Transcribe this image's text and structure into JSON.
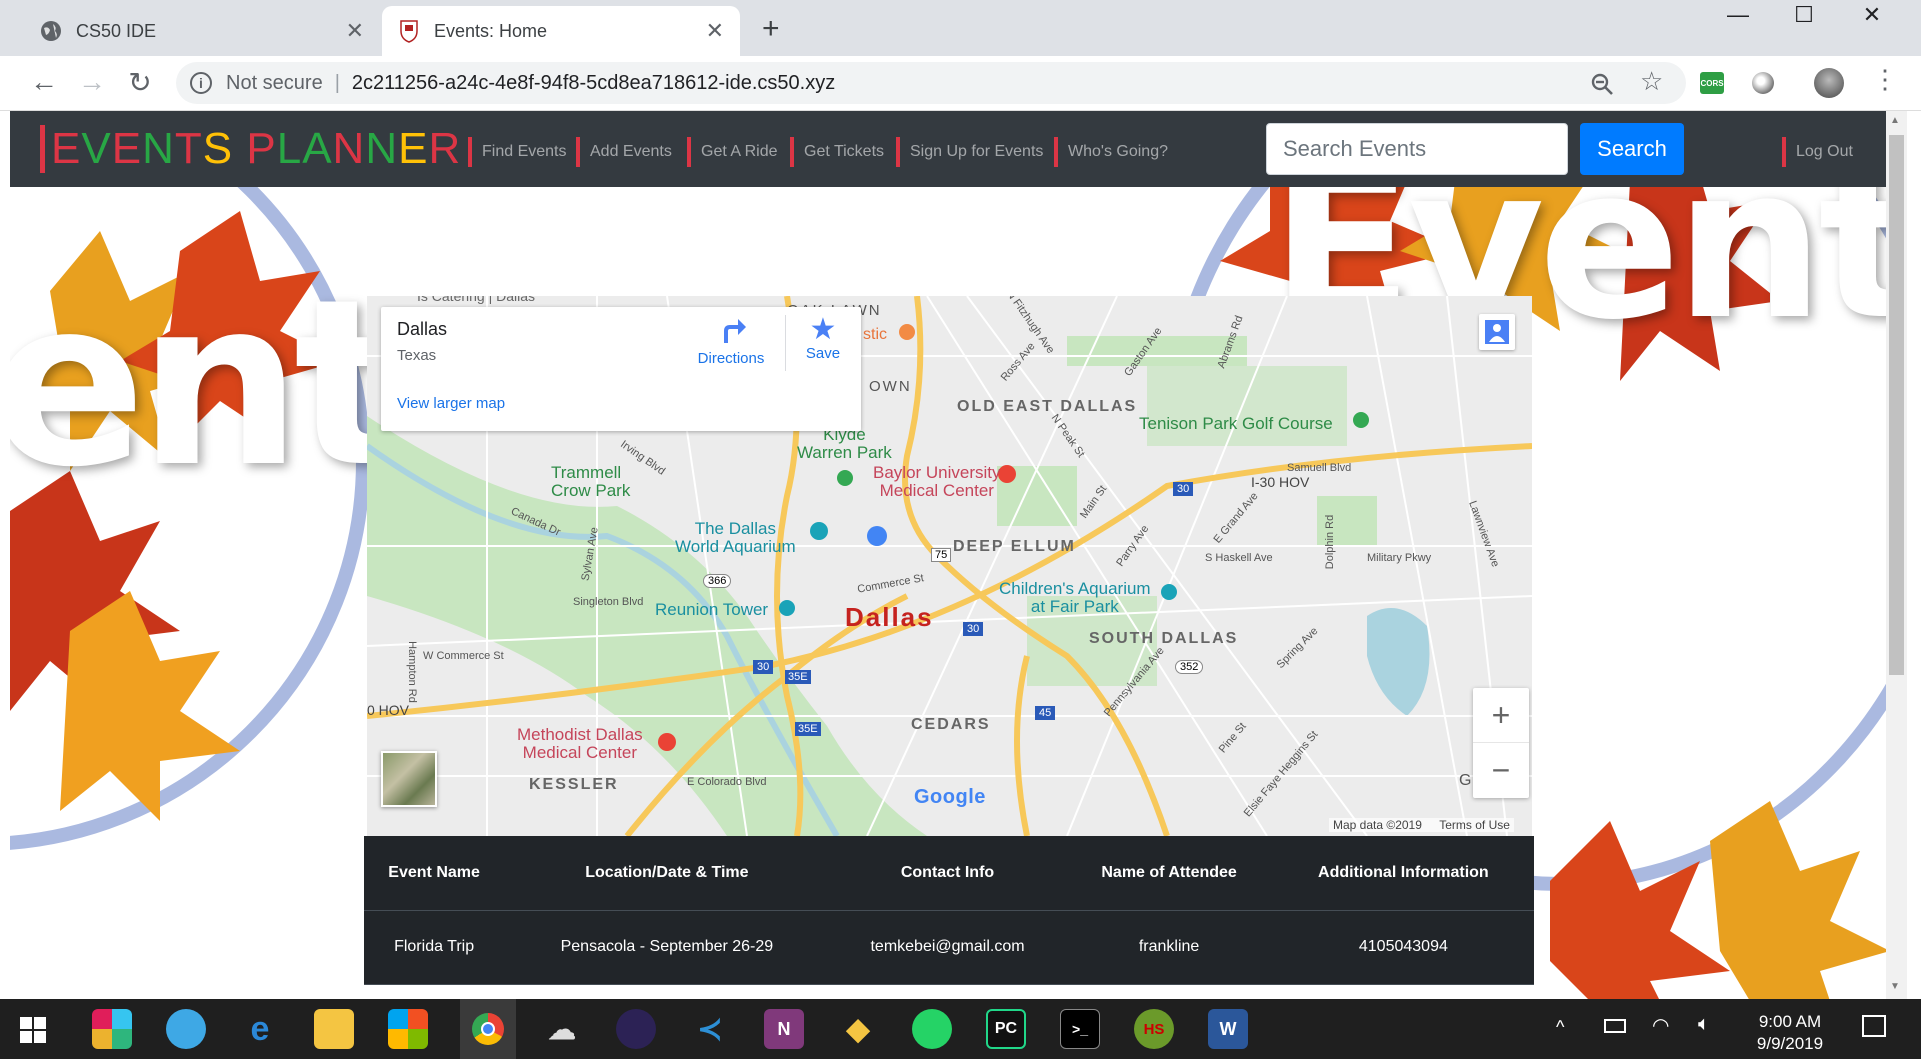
{
  "browser": {
    "tabs": [
      {
        "title": "CS50 IDE",
        "close": "✕"
      },
      {
        "title": "Events: Home",
        "close": "✕"
      }
    ],
    "new_tab": "+",
    "window_controls": {
      "minimize": "—",
      "maximize": "☐",
      "close": "✕"
    },
    "security_label": "Not secure",
    "url": "2c211256-a24c-4e8f-94f8-5cd8ea718612-ide.cs50.xyz",
    "cors_badge": "CORS"
  },
  "navbar": {
    "brand_letters": [
      {
        "ch": "E",
        "color": "#dc3545"
      },
      {
        "ch": "V",
        "color": "#28a745"
      },
      {
        "ch": "E",
        "color": "#dc3545"
      },
      {
        "ch": "N",
        "color": "#28a745"
      },
      {
        "ch": "T",
        "color": "#dc3545"
      },
      {
        "ch": "S",
        "color": "#ffc107"
      },
      {
        "ch": " ",
        "color": "#ffffff"
      },
      {
        "ch": "P",
        "color": "#dc3545"
      },
      {
        "ch": "L",
        "color": "#28a745"
      },
      {
        "ch": "A",
        "color": "#28a745"
      },
      {
        "ch": "N",
        "color": "#dc3545"
      },
      {
        "ch": "N",
        "color": "#28a745"
      },
      {
        "ch": "E",
        "color": "#ffc107"
      },
      {
        "ch": "R",
        "color": "#dc3545"
      }
    ],
    "links": [
      "Find Events",
      "Add Events",
      "Get A Ride",
      "Get Tickets",
      "Sign Up for Events",
      "Who's Going?"
    ],
    "search_placeholder": "Search Events",
    "search_button": "Search",
    "logout": "Log Out",
    "accent": "#dc3545"
  },
  "background": {
    "word_left": "ents",
    "word_right": "Events"
  },
  "map": {
    "card": {
      "place": "Dallas",
      "region": "Texas",
      "directions": "Directions",
      "save": "Save",
      "larger_map": "View larger map"
    },
    "labels": {
      "city": "Dallas",
      "old_east": "OLD EAST DALLAS",
      "tenison": "Tenison Park Golf Course",
      "trammell": "Trammell\nCrow Park",
      "klyde": "Klyde\nWarren Park",
      "baylor": "Baylor University\nMedical Center",
      "aquarium": "The Dallas\nWorld Aquarium",
      "deep_ellum": "DEEP ELLUM",
      "childrens": "Children's Aquarium\nat Fair Park",
      "reunion": "Reunion Tower",
      "south_dallas": "SOUTH DALLAS",
      "cedars": "CEDARS",
      "methodist": "Methodist Dallas\nMedical Center",
      "kessler": "KESSLER",
      "hov_right": "I-30 HOV",
      "hov_left": "0 HOV",
      "downtown": "OWN",
      "oak_lawn": "OAK LAWN",
      "catering": "Is Catering | Dallas",
      "stic": "stic",
      "irving": "Irving Blvd",
      "canada": "Canada Dr",
      "sylvan": "Sylvan Ave",
      "singleton": "Singleton Blvd",
      "commerce": "Commerce St",
      "w_commerce": "W Commerce St",
      "hampton": "Hampton Rd",
      "colorado": "E Colorado Blvd",
      "main": "Main St",
      "peak": "N Peak St",
      "haskell": "S Haskell Ave",
      "military": "Military Pkwy",
      "samuell": "Samuell Blvd",
      "dolphin": "Dolphin Rd",
      "lawnview": "Lawnview Ave",
      "grand": "E Grand Ave",
      "spring": "Spring Ave",
      "pine": "Pine St",
      "elsie": "Elsie Faye Heggins St",
      "pennsylvania": "Pennsylvania Ave",
      "parry": "Parry Ave",
      "gaston": "Gaston Ave",
      "abrams": "Abrams Rd",
      "ross": "Ross Ave",
      "fitzhugh": "N Fitzhugh Ave",
      "r366": "366",
      "r75": "75",
      "r30a": "30",
      "r30b": "30",
      "r30c": "30",
      "r35e_a": "35E",
      "r35e_b": "35E",
      "r45": "45",
      "r352": "352"
    },
    "zoom_in": "+",
    "zoom_out": "−",
    "google": "Google",
    "map_data": "Map data ©2019",
    "terms": "Terms of Use",
    "edge_g": "G",
    "colors": {
      "park": "#c8e6c0",
      "water": "#aad3df",
      "highway": "#f7c85a",
      "road": "#ffffff",
      "land": "#ececec"
    }
  },
  "table": {
    "headers": [
      "Event Name",
      "Location/Date & Time",
      "Contact Info",
      "Name of Attendee",
      "Additional Information"
    ],
    "rows": [
      [
        "Florida Trip",
        "Pensacola - September 26-29",
        "temkebei@gmail.com",
        "frankline",
        "4105043094"
      ]
    ]
  },
  "taskbar": {
    "time": "9:00 AM",
    "date": "9/9/2019",
    "icons": [
      "windows-start",
      "slack",
      "teams",
      "edge",
      "file-explorer",
      "store",
      "chrome",
      "soundcloud",
      "eclipse",
      "vscode",
      "onenote",
      "git-kraken",
      "whatsapp",
      "pycharm",
      "terminal",
      "hs",
      "word"
    ],
    "labels": {
      "pycharm": "PC",
      "hs": "HS",
      "word": "W",
      "onenote": "N"
    }
  }
}
